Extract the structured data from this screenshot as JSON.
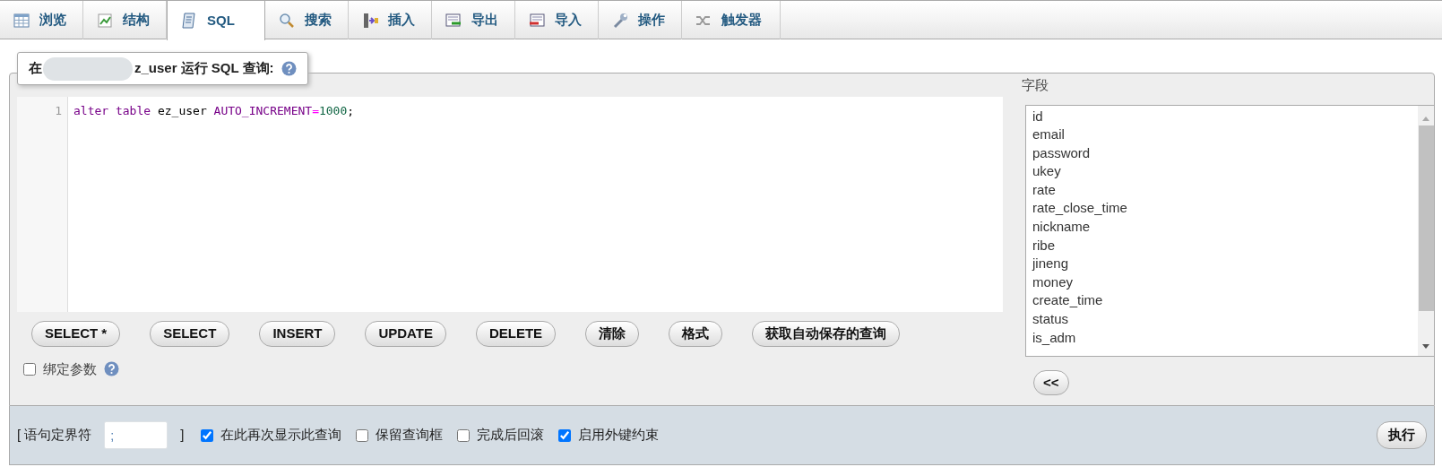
{
  "tabs": [
    {
      "label": "浏览",
      "selected": false
    },
    {
      "label": "结构",
      "selected": false
    },
    {
      "label": "SQL",
      "selected": true
    },
    {
      "label": "搜索",
      "selected": false
    },
    {
      "label": "插入",
      "selected": false
    },
    {
      "label": "导出",
      "selected": false
    },
    {
      "label": "导入",
      "selected": false
    },
    {
      "label": "操作",
      "selected": false
    },
    {
      "label": "触发器",
      "selected": false
    }
  ],
  "legend": {
    "start": "在",
    "end": "z_user 运行 SQL 查询:"
  },
  "editor": {
    "lines": [
      {
        "number": "1",
        "words": [
          [
            {
              "text": "alter",
              "kind": "keyword"
            }
          ],
          [
            {
              "text": "table",
              "kind": "keyword"
            }
          ],
          [
            {
              "text": "ez_user",
              "kind": "name"
            }
          ],
          [
            {
              "text": "AUTO_INCREMENT",
              "kind": "keyword"
            },
            {
              "text": "=",
              "kind": "operator"
            },
            {
              "text": "1000",
              "kind": "number"
            },
            {
              "text": ";",
              "kind": "punct"
            }
          ]
        ]
      }
    ]
  },
  "query_buttons": [
    "SELECT *",
    "SELECT",
    "INSERT",
    "UPDATE",
    "DELETE",
    "清除",
    "格式",
    "获取自动保存的查询"
  ],
  "bind_parameters": {
    "label": "绑定参数",
    "checked": false
  },
  "fields": {
    "title": "字段",
    "items": [
      "id",
      "email",
      "password",
      "ukey",
      "rate",
      "rate_close_time",
      "nickname",
      "ribe",
      "jineng",
      "money",
      "create_time",
      "status",
      "is_adm"
    ],
    "insert_button": "<<"
  },
  "footer": {
    "delimiter_label": "[ 语句定界符",
    "delimiter_value": ";",
    "delimiter_close": "]",
    "options": [
      {
        "label": "在此再次显示此查询",
        "checked": true
      },
      {
        "label": "保留查询框",
        "checked": false
      },
      {
        "label": "完成后回滚",
        "checked": false
      },
      {
        "label": "启用外键约束",
        "checked": true
      }
    ],
    "go_button": "执行"
  }
}
